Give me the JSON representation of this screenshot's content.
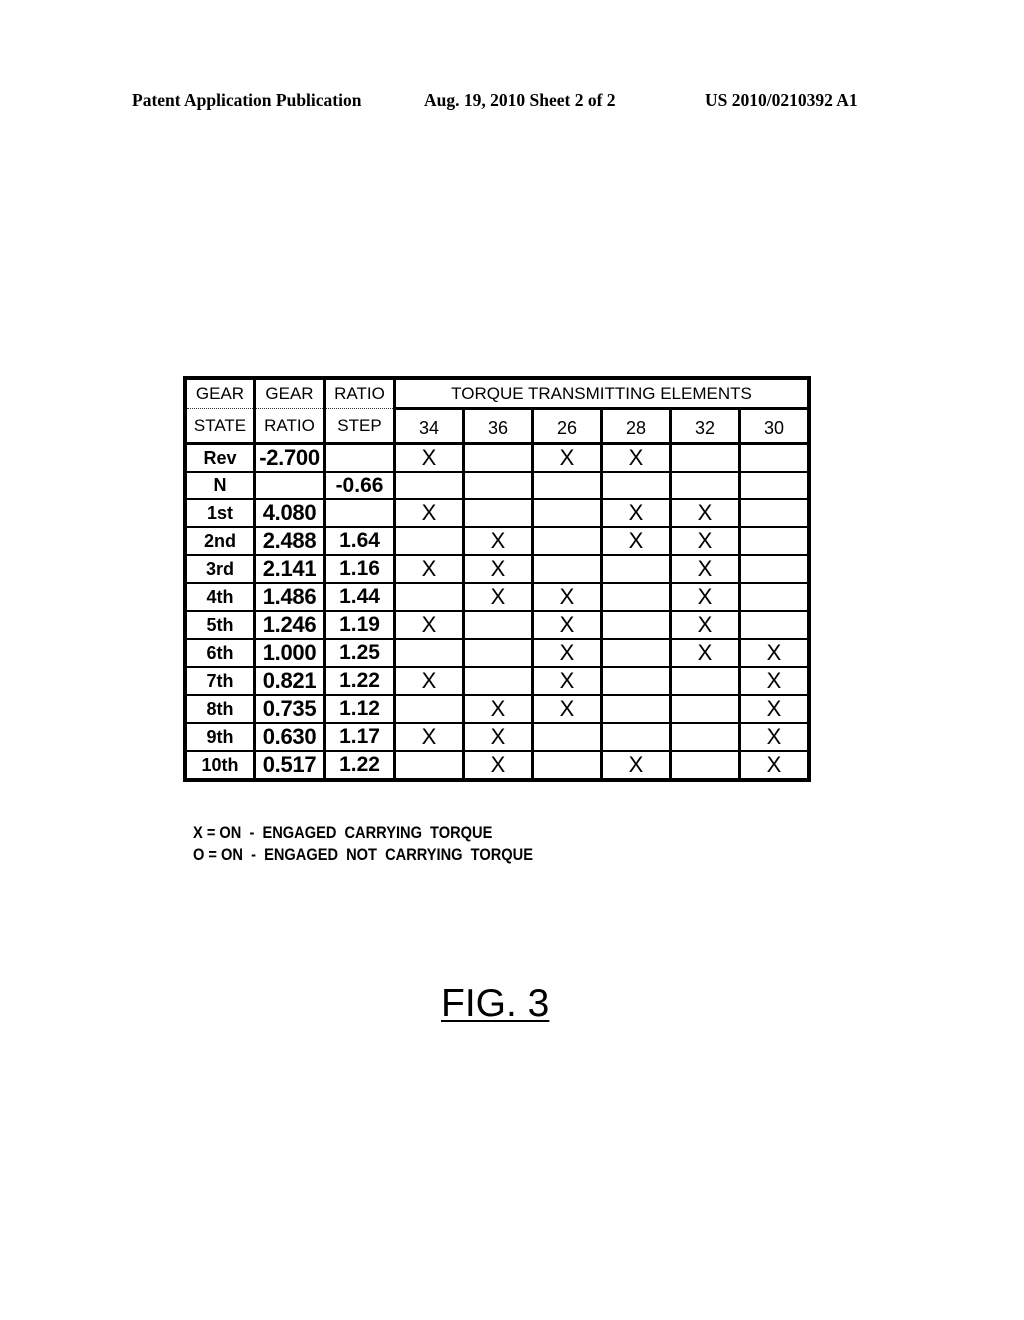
{
  "header": {
    "left": "Patent Application Publication",
    "middle": "Aug. 19, 2010  Sheet 2 of 2",
    "right": "US 2010/0210392 A1"
  },
  "table": {
    "col_headers": {
      "gear_state": [
        "GEAR",
        "STATE"
      ],
      "gear_ratio": [
        "GEAR",
        "RATIO"
      ],
      "ratio_step": [
        "RATIO",
        "STEP"
      ],
      "torque_group": "TORQUE TRANSMITTING ELEMENTS",
      "elements": [
        "34",
        "36",
        "26",
        "28",
        "32",
        "30"
      ]
    },
    "rows": [
      {
        "state": "Rev",
        "ratio": "-2.700",
        "step": "",
        "marks": [
          "X",
          "",
          "X",
          "X",
          "",
          ""
        ]
      },
      {
        "state": "N",
        "ratio": "",
        "step": "-0.66",
        "marks": [
          "",
          "",
          "",
          "",
          "",
          ""
        ]
      },
      {
        "state": "1st",
        "ratio": "4.080",
        "step": "",
        "marks": [
          "X",
          "",
          "",
          "X",
          "X",
          ""
        ]
      },
      {
        "state": "2nd",
        "ratio": "2.488",
        "step": "1.64",
        "marks": [
          "",
          "X",
          "",
          "X",
          "X",
          ""
        ]
      },
      {
        "state": "3rd",
        "ratio": "2.141",
        "step": "1.16",
        "marks": [
          "X",
          "X",
          "",
          "",
          "X",
          ""
        ]
      },
      {
        "state": "4th",
        "ratio": "1.486",
        "step": "1.44",
        "marks": [
          "",
          "X",
          "X",
          "",
          "X",
          ""
        ]
      },
      {
        "state": "5th",
        "ratio": "1.246",
        "step": "1.19",
        "marks": [
          "X",
          "",
          "X",
          "",
          "X",
          ""
        ]
      },
      {
        "state": "6th",
        "ratio": "1.000",
        "step": "1.25",
        "marks": [
          "",
          "",
          "X",
          "",
          "X",
          "X"
        ]
      },
      {
        "state": "7th",
        "ratio": "0.821",
        "step": "1.22",
        "marks": [
          "X",
          "",
          "X",
          "",
          "",
          "X"
        ]
      },
      {
        "state": "8th",
        "ratio": "0.735",
        "step": "1.12",
        "marks": [
          "",
          "X",
          "X",
          "",
          "",
          "X"
        ]
      },
      {
        "state": "9th",
        "ratio": "0.630",
        "step": "1.17",
        "marks": [
          "X",
          "X",
          "",
          "",
          "",
          "X"
        ]
      },
      {
        "state": "10th",
        "ratio": "0.517",
        "step": "1.22",
        "marks": [
          "",
          "X",
          "",
          "X",
          "",
          "X"
        ]
      }
    ]
  },
  "legend": {
    "line1": "X = ON  -  ENGAGED  CARRYING  TORQUE",
    "line2": "O = ON  -  ENGAGED  NOT  CARRYING  TORQUE"
  },
  "figure_label": "FIG. 3"
}
